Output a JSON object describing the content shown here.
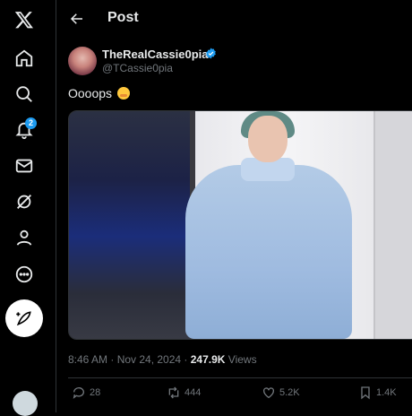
{
  "sidebar": {
    "items": [
      {
        "icon": "x-logo-icon"
      },
      {
        "icon": "home-icon"
      },
      {
        "icon": "search-icon"
      },
      {
        "icon": "bell-icon",
        "badge": "2"
      },
      {
        "icon": "mail-icon"
      },
      {
        "icon": "grok-icon"
      },
      {
        "icon": "profile-icon"
      },
      {
        "icon": "more-icon"
      }
    ],
    "compose_icon": "feather-icon"
  },
  "header": {
    "title": "Post"
  },
  "tweet": {
    "author_name": "TheRealCassie0pia",
    "author_handle": "@TCassie0pia",
    "verified": true,
    "text": "Oooops",
    "emoji": "hand-over-mouth-emoji",
    "time": "8:46 AM · Nov 24, 2024 · ",
    "views_count": "247.9K",
    "views_label": " Views"
  },
  "actions": {
    "replies": "28",
    "reposts": "444",
    "likes": "5.2K",
    "bookmarks": "1.4K"
  },
  "colors": {
    "background": "#000000",
    "text_primary": "#e7e9ea",
    "text_secondary": "#71767b",
    "accent": "#1d9bf0",
    "border": "#2f3336"
  }
}
